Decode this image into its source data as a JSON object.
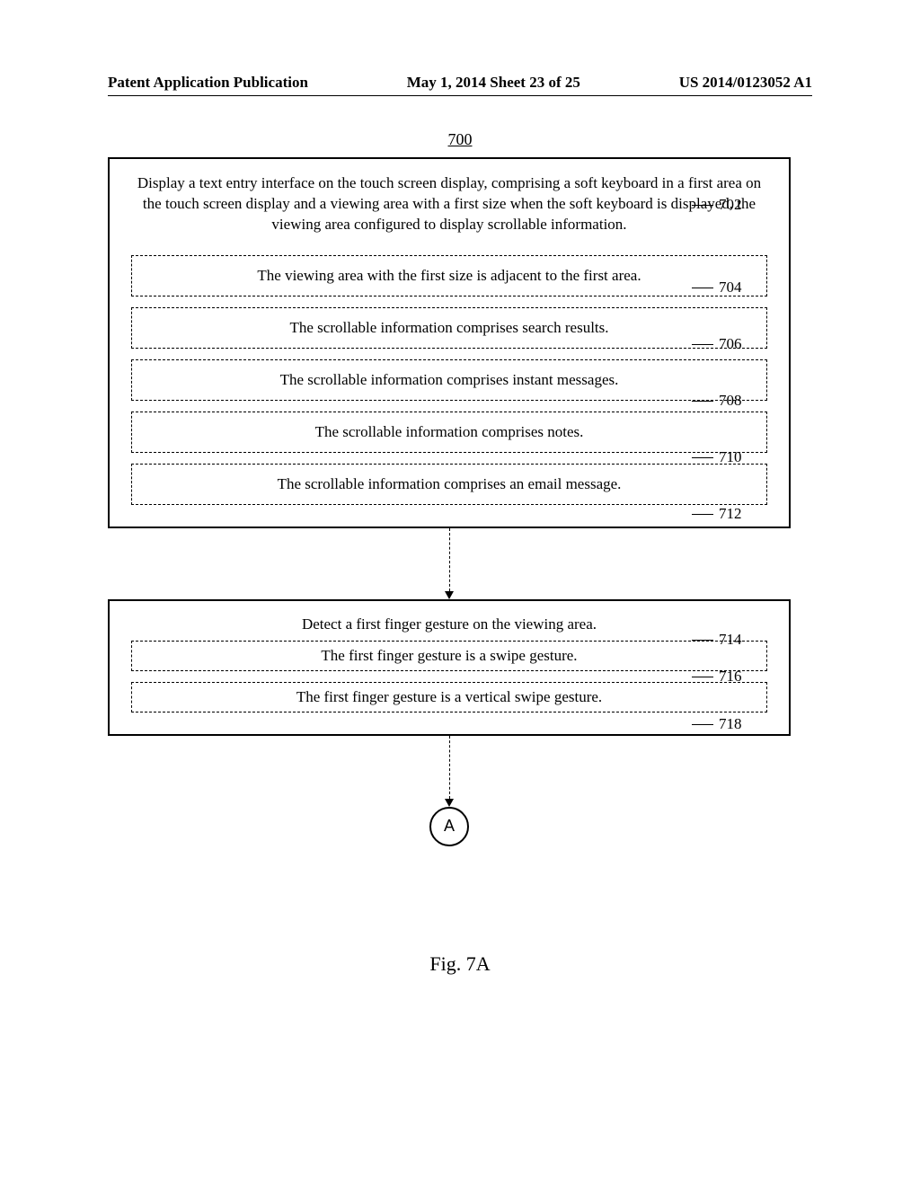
{
  "header": {
    "left": "Patent Application Publication",
    "center": "May 1, 2014  Sheet 23 of 25",
    "right": "US 2014/0123052 A1"
  },
  "figure_number": "700",
  "box1": {
    "main": "Display a text entry interface on the touch screen display, comprising a soft keyboard in a first area on the touch screen display and a viewing area with a first size when the soft keyboard is displayed, the viewing area configured to display scrollable information.",
    "ref": "702",
    "subs": [
      {
        "text": "The viewing area with the first size is adjacent to the first area.",
        "ref": "704"
      },
      {
        "text": "The scrollable information comprises search results.",
        "ref": "706"
      },
      {
        "text": "The scrollable information comprises instant messages.",
        "ref": "708"
      },
      {
        "text": "The scrollable information comprises notes.",
        "ref": "710"
      },
      {
        "text": "The scrollable information comprises an email message.",
        "ref": "712"
      }
    ]
  },
  "box2": {
    "main": "Detect a first finger gesture on the viewing area.",
    "ref": "714",
    "subs": [
      {
        "text": "The first finger gesture is a swipe gesture.",
        "ref": "716"
      },
      {
        "text": "The first finger gesture is a vertical swipe gesture.",
        "ref": "718"
      }
    ]
  },
  "connector_label": "A",
  "caption": "Fig. 7A",
  "chart_data": {
    "type": "flowchart",
    "title": "700",
    "nodes": [
      {
        "id": "702",
        "text": "Display a text entry interface on the touch screen display, comprising a soft keyboard in a first area on the touch screen display and a viewing area with a first size when the soft keyboard is displayed, the viewing area configured to display scrollable information.",
        "style": "solid",
        "children": [
          {
            "id": "704",
            "text": "The viewing area with the first size is adjacent to the first area.",
            "style": "dashed"
          },
          {
            "id": "706",
            "text": "The scrollable information comprises search results.",
            "style": "dashed"
          },
          {
            "id": "708",
            "text": "The scrollable information comprises instant messages.",
            "style": "dashed"
          },
          {
            "id": "710",
            "text": "The scrollable information comprises notes.",
            "style": "dashed"
          },
          {
            "id": "712",
            "text": "The scrollable information comprises an email message.",
            "style": "dashed"
          }
        ]
      },
      {
        "id": "714",
        "text": "Detect a first finger gesture on the viewing area.",
        "style": "solid",
        "children": [
          {
            "id": "716",
            "text": "The first finger gesture is a swipe gesture.",
            "style": "dashed"
          },
          {
            "id": "718",
            "text": "The first finger gesture is a vertical swipe gesture.",
            "style": "dashed"
          }
        ]
      },
      {
        "id": "A",
        "text": "A",
        "style": "circle"
      }
    ],
    "edges": [
      {
        "from": "702",
        "to": "714",
        "style": "dashed"
      },
      {
        "from": "714",
        "to": "A",
        "style": "dashed"
      }
    ],
    "caption": "Fig. 7A"
  }
}
